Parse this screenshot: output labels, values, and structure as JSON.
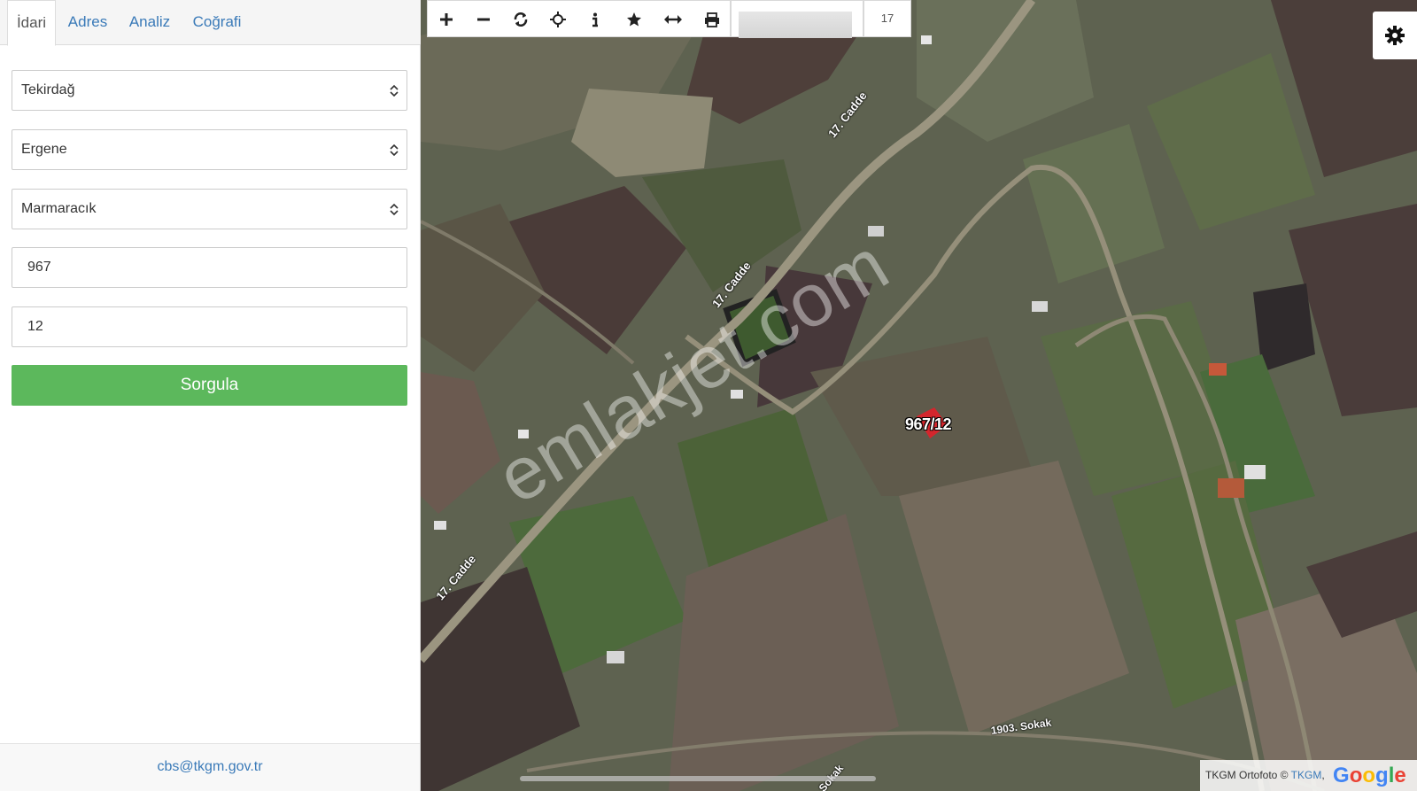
{
  "tabs": [
    {
      "label": "İdari",
      "active": true
    },
    {
      "label": "Adres",
      "active": false
    },
    {
      "label": "Analiz",
      "active": false
    },
    {
      "label": "Coğrafi",
      "active": false
    }
  ],
  "form": {
    "province": "Tekirdağ",
    "district": "Ergene",
    "neighborhood": "Marmaracık",
    "block_no": "967",
    "parcel_no": "12",
    "submit_label": "Sorgula"
  },
  "footer": {
    "email": "cbs@tkgm.gov.tr"
  },
  "toolbar": {
    "icons": [
      "zoom-in-icon",
      "zoom-out-icon",
      "refresh-icon",
      "crosshair-icon",
      "info-icon",
      "star-icon",
      "measure-icon",
      "print-icon"
    ],
    "zoom_level": "17"
  },
  "map": {
    "parcel_label": "967/12",
    "road_labels": [
      "17. Cadde",
      "17. Cadde",
      "17. Cadde",
      "1903. Sokak",
      "Sokak"
    ],
    "watermark": "emlakjet.com",
    "attribution_prefix": "TKGM Ortofoto © ",
    "attribution_link": "TKGM",
    "attribution_suffix": ",",
    "google_logo": "Google",
    "parcel_color": "#e0202a"
  }
}
